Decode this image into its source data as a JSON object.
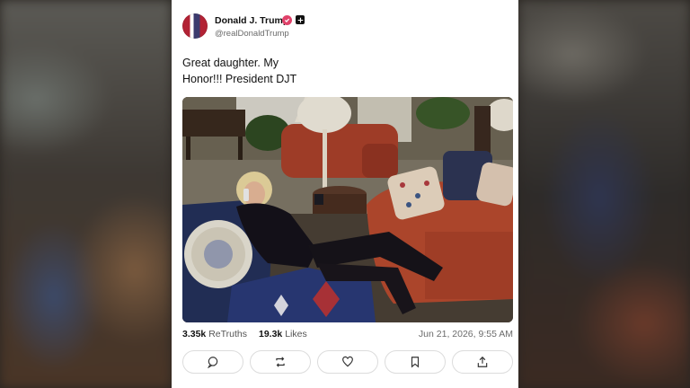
{
  "post": {
    "author_name": "Donald J. Trump",
    "handle": "@realDonaldTrump",
    "text_line1": "Great daughter. My",
    "text_line2": "Honor!!! President DJT"
  },
  "stats": {
    "retruths_count": "3.35k",
    "retruths_label": "ReTruths",
    "likes_count": "19.3k",
    "likes_label": "Likes",
    "timestamp": "Jun 21, 2026, 9:55 AM"
  },
  "actions": [
    {
      "name": "reply-button",
      "icon": "comment-icon"
    },
    {
      "name": "retruth-button",
      "icon": "repost-icon"
    },
    {
      "name": "like-button",
      "icon": "heart-icon"
    },
    {
      "name": "bookmark-button",
      "icon": "bookmark-icon"
    },
    {
      "name": "share-button",
      "icon": "share-icon"
    }
  ],
  "colors": {
    "verified_badge": "#e0426a",
    "text_primary": "#111111",
    "text_secondary": "#6b6b6b"
  }
}
